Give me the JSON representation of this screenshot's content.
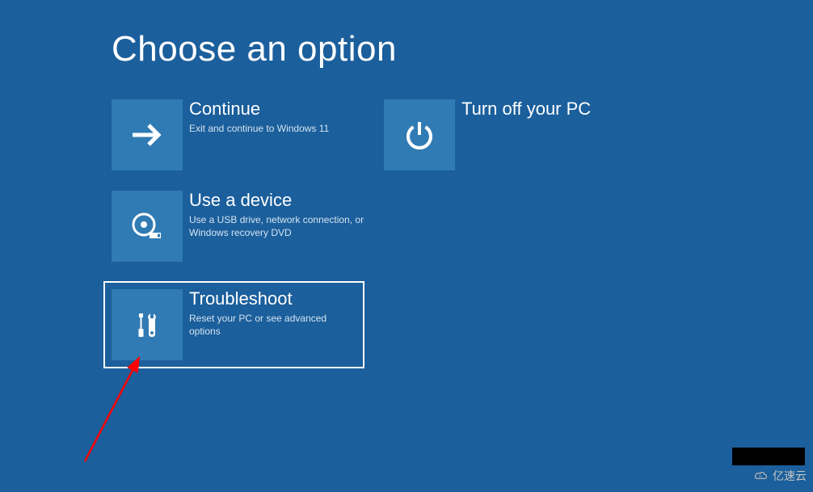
{
  "page": {
    "title": "Choose an option"
  },
  "options": {
    "continue": {
      "title": "Continue",
      "desc": "Exit and continue to Windows 11"
    },
    "device": {
      "title": "Use a device",
      "desc": "Use a USB drive, network connection, or Windows recovery DVD"
    },
    "troubleshoot": {
      "title": "Troubleshoot",
      "desc": "Reset your PC or see advanced options"
    },
    "turnoff": {
      "title": "Turn off your PC",
      "desc": ""
    }
  },
  "watermark": {
    "text": "亿速云"
  },
  "colors": {
    "background": "#1b5f9c",
    "tile": "#317bb4",
    "text": "#ffffff"
  }
}
